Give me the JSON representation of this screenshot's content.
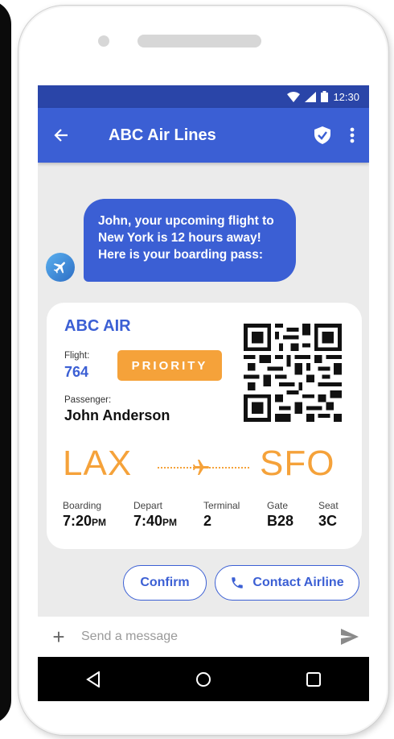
{
  "status": {
    "time": "12:30"
  },
  "appbar": {
    "title": "ABC Air Lines"
  },
  "message": {
    "lines": [
      "John, your upcoming flight to",
      "New York is 12 hours away!",
      "Here is your boarding pass:"
    ]
  },
  "pass": {
    "airline": "ABC AIR",
    "flight_label": "Flight:",
    "flight_number": "764",
    "badge": "PRIORITY",
    "passenger_label": "Passenger:",
    "passenger_name": "John Anderson",
    "origin": "LAX",
    "destination": "SFO",
    "details": {
      "boarding_label": "Boarding",
      "boarding_time": "7:20",
      "boarding_period": "PM",
      "depart_label": "Depart",
      "depart_time": "7:40",
      "depart_period": "PM",
      "terminal_label": "Terminal",
      "terminal": "2",
      "gate_label": "Gate",
      "gate": "B28",
      "seat_label": "Seat",
      "seat": "3C"
    }
  },
  "actions": {
    "confirm": "Confirm",
    "contact": "Contact Airline"
  },
  "composer": {
    "placeholder": "Send a message"
  },
  "colors": {
    "primary": "#3b5fd4",
    "status": "#2a45a8",
    "accent": "#f5a23a"
  },
  "icons": [
    "back-arrow-icon",
    "shield-check-icon",
    "more-vert-icon",
    "plane-icon",
    "phone-icon",
    "plus-icon",
    "send-icon",
    "nav-back-icon",
    "nav-home-icon",
    "nav-recents-icon",
    "wifi-icon",
    "signal-icon",
    "battery-icon",
    "qr-code-icon"
  ]
}
